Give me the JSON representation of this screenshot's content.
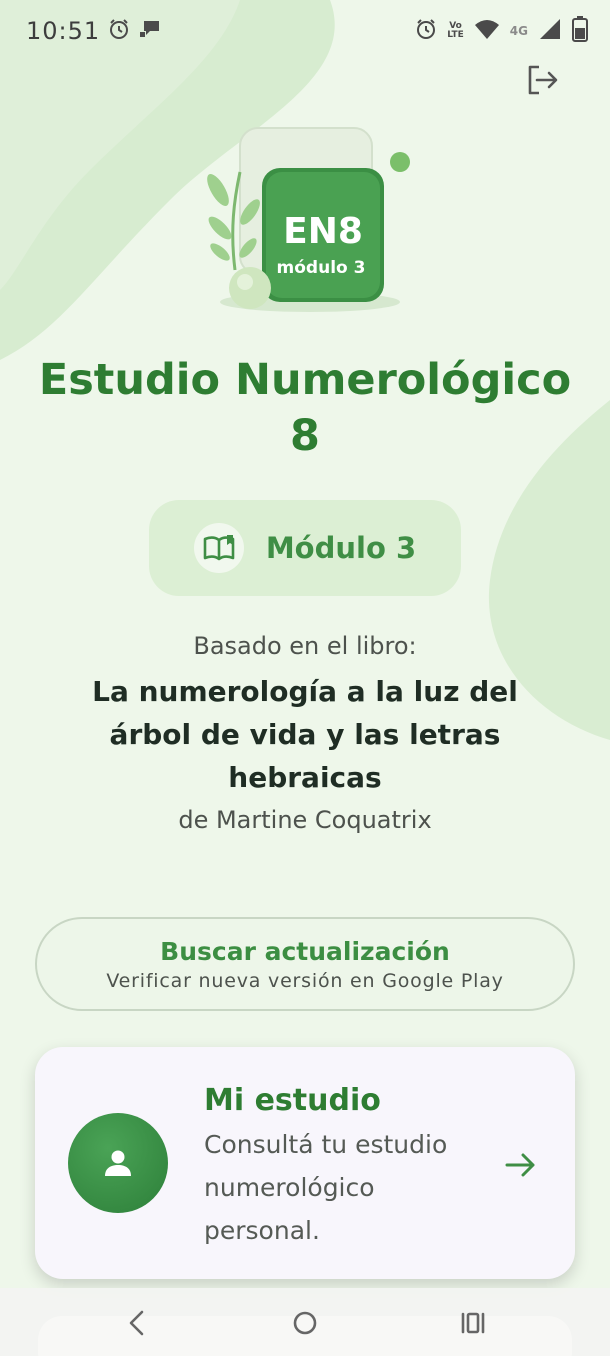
{
  "status_bar": {
    "time": "10:51",
    "network": "4G",
    "volte_top": "Vo",
    "volte_bottom": "LTE",
    "icons": [
      "alarm-icon",
      "message-icon",
      "alarm-icon",
      "volte-icon",
      "wifi-icon",
      "signal-icon",
      "battery-icon"
    ]
  },
  "header": {
    "logout_icon": "logout-icon"
  },
  "hero": {
    "badge_title": "EN8",
    "badge_subtitle": "módulo 3"
  },
  "app": {
    "title_line1": "Estudio Numerológico",
    "title_line2": "8"
  },
  "module": {
    "label": "Módulo 3",
    "icon": "book-icon"
  },
  "book": {
    "intro": "Basado en el libro:",
    "title_line1": "La numerología a la luz del",
    "title_line2": "árbol de vida y las letras",
    "title_line3": "hebraicas",
    "author": "de Martine Coquatrix"
  },
  "update_button": {
    "title": "Buscar actualización",
    "subtitle": "Verificar nueva versión en Google Play"
  },
  "study_card": {
    "title": "Mi estudio",
    "desc_line1": "Consultá tu estudio",
    "desc_line2": "numerológico",
    "desc_line3": "personal.",
    "icon": "person-icon",
    "arrow_icon": "arrow-right-icon"
  },
  "nav": {
    "back_icon": "back-icon",
    "home_icon": "home-icon",
    "recents_icon": "recents-icon"
  },
  "colors": {
    "primary": "#2e7d32",
    "accent": "#3f8e45",
    "background": "#eef7ea",
    "card": "#f8f6fc"
  }
}
